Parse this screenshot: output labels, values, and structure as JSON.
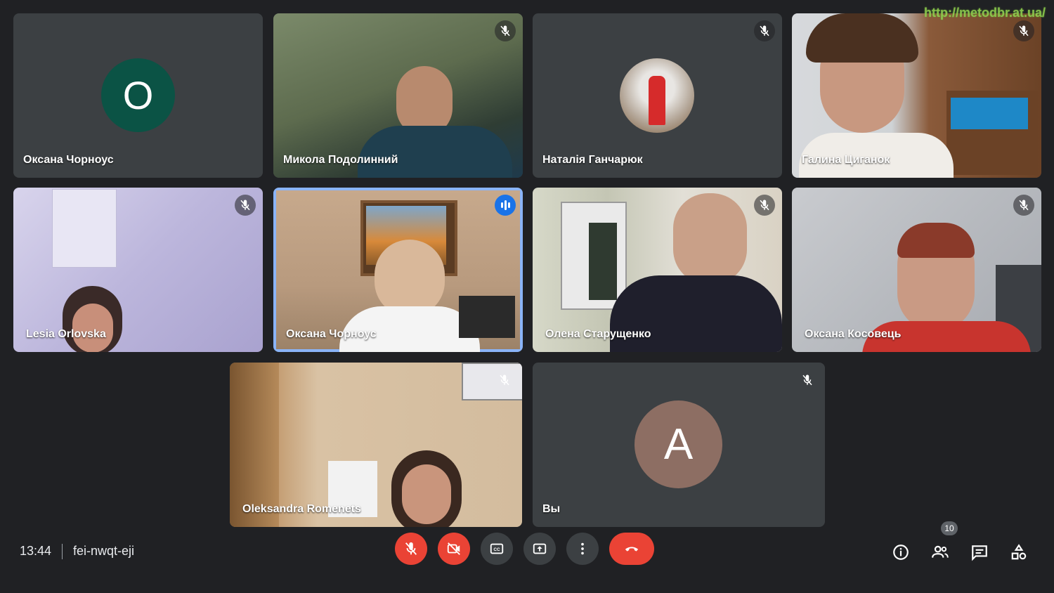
{
  "watermark": "http://metodbr.at.ua/",
  "participants": [
    {
      "name": "Оксана Чорноус",
      "initial": "О",
      "avatar_color": "#0b5345",
      "muted": false
    },
    {
      "name": "Микола Подолинний",
      "muted": true
    },
    {
      "name": "Наталія Ганчарюк",
      "muted": true
    },
    {
      "name": "Галина Циганок",
      "muted": true
    },
    {
      "name": "Lesia Orlovska",
      "muted": true
    },
    {
      "name": "Оксана Чорноус",
      "speaking": true
    },
    {
      "name": "Олена Старущенко",
      "muted": true
    },
    {
      "name": "Оксана Косовець",
      "muted": true
    },
    {
      "name": "Oleksandra Romenets",
      "muted": true
    },
    {
      "name": "Вы",
      "initial": "А",
      "avatar_color": "#8d6e63",
      "muted": true
    }
  ],
  "bottom_bar": {
    "time": "13:44",
    "meeting_code": "fei-nwqt-eji",
    "participant_count": "10"
  },
  "colors": {
    "background": "#202124",
    "tile": "#3c4043",
    "accent": "#8ab4f8",
    "danger": "#ea4335"
  }
}
